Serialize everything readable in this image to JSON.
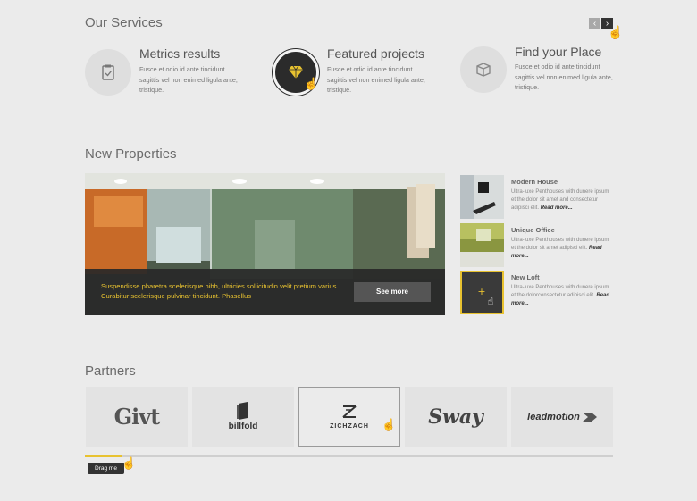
{
  "services": {
    "title": "Our Services",
    "prev_label": "‹",
    "next_label": "›",
    "items": [
      {
        "title": "Metrics results",
        "text": "Fusce et odio id ante tincidunt sagittis vel non enimed ligula ante, tristique.",
        "icon": "clipboard-check-icon"
      },
      {
        "title": "Featured projects",
        "text": "Fusce et odio id ante tincidunt sagittis vel non enimed ligula ante, tristique.",
        "icon": "diamond-icon"
      },
      {
        "title": "Find your Place",
        "text": "Fusce et odio id ante tincidunt sagittis vel non enimed ligula ante, tristique.",
        "icon": "box-icon"
      }
    ]
  },
  "properties": {
    "title": "New Properties",
    "featured_caption": "Suspendisse pharetra scelerisque nibh, ultricies sollicitudin velit pretium varius. Curabitur scelerisque pulvinar tincidunt. Phasellus",
    "see_more": "See more",
    "list": [
      {
        "name": "Modern House",
        "desc": "Ultra-luxe Penthouses with dunere ipsum et the dolor sit amet and consectetur adipisci elit.",
        "read_more": "Read more..."
      },
      {
        "name": "Unique Office",
        "desc": "Ultra-luxe Penthouses with dunere ipsum et the dolor sit amet adipisci elit.",
        "read_more": "Read more..."
      },
      {
        "name": "New Loft",
        "desc": "Ultra-luxe Penthouses with dunere ipsum et the dolorconsectetur adipisci elit.",
        "read_more": "Read more..."
      }
    ]
  },
  "partners": {
    "title": "Partners",
    "logos": [
      "Givt",
      "billfold",
      "ZICHZACH",
      "Sway",
      "leadmotion"
    ],
    "drag_label": "Drag me",
    "scroll_progress": 0.07
  },
  "colors": {
    "accent": "#e8c230",
    "dark": "#2b2b2b"
  }
}
